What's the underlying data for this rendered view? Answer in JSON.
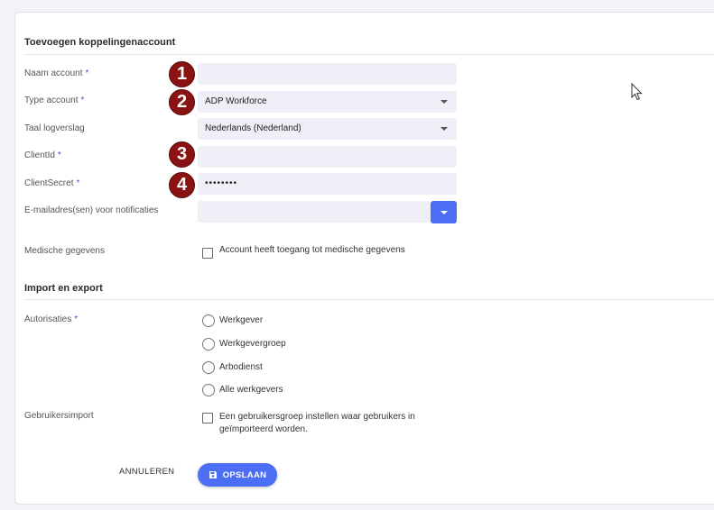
{
  "form": {
    "title": "Toevoegen koppelingenaccount",
    "fields": {
      "naam": {
        "label": "Naam account",
        "required": "*",
        "value": "",
        "badge": "1"
      },
      "type": {
        "label": "Type account",
        "required": "*",
        "value": "ADP Workforce",
        "badge": "2"
      },
      "taal": {
        "label": "Taal logverslag",
        "value": "Nederlands (Nederland)"
      },
      "clientid": {
        "label": "ClientId",
        "required": "*",
        "value": "",
        "badge": "3"
      },
      "secret": {
        "label": "ClientSecret",
        "required": "*",
        "value": "••••••••",
        "badge": "4"
      },
      "email": {
        "label": "E-mailadres(sen) voor notificaties",
        "value": ""
      }
    },
    "medisch": {
      "label": "Medische gegevens",
      "checkbox_text": "Account heeft toegang tot medische gegevens"
    }
  },
  "import": {
    "title": "Import en export",
    "autorisaties": {
      "label": "Autorisaties",
      "required": "*",
      "options": [
        "Werkgever",
        "Werkgevergroep",
        "Arbodienst",
        "Alle werkgevers"
      ]
    },
    "gebruikersimport": {
      "label": "Gebruikersimport",
      "checkbox_line1": "Een gebruikersgroep instellen waar gebruikers in",
      "checkbox_line2": "geïmporteerd worden."
    }
  },
  "actions": {
    "cancel": "ANNULEREN",
    "save": "OPSLAAN"
  },
  "colors": {
    "accent": "#4c6ef5",
    "badge": "#8b1212",
    "field_bg": "#efeff8"
  }
}
